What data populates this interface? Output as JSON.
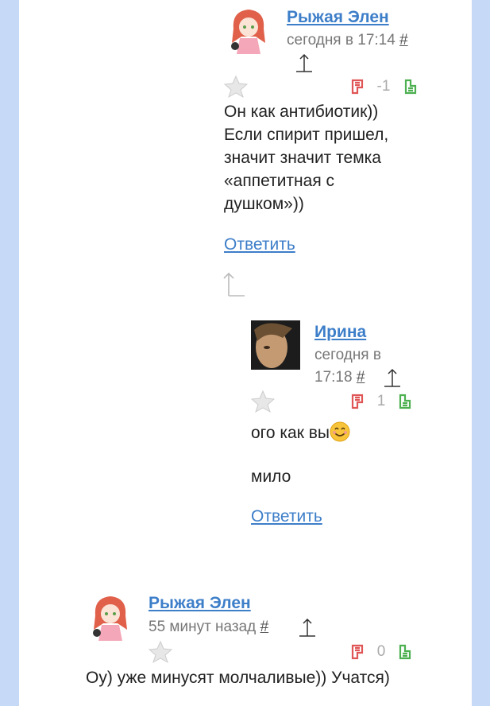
{
  "comments": [
    {
      "author": "Рыжая Элен",
      "time": "сегодня в 17:14",
      "anchor": "#",
      "score": "-1",
      "text_lines": [
        "Он как антибиотик))",
        "Если спирит пришел,",
        "значит значит темка",
        "«аппетитная с",
        "душком»))"
      ],
      "reply": "Ответить"
    },
    {
      "author": "Ирина",
      "time_line1": "сегодня в",
      "time_line2": "17:18",
      "anchor": "#",
      "score": "1",
      "text1": "ого как вы",
      "text2": "мило",
      "reply": "Ответить"
    },
    {
      "author": "Рыжая Элен",
      "time": "55 минут назад",
      "anchor": "#",
      "score": "0",
      "text": "Оу) уже минусят молчаливые)) Учатся)"
    }
  ],
  "icons": {
    "star": "star-icon",
    "vote_down": "thumb-down-icon",
    "vote_up": "thumb-up-icon",
    "parent": "up-arrow-icon"
  },
  "colors": {
    "background": "#c6daf7",
    "link": "#3d7ec9",
    "vote_down": "#e05555",
    "vote_up": "#4caf50"
  }
}
